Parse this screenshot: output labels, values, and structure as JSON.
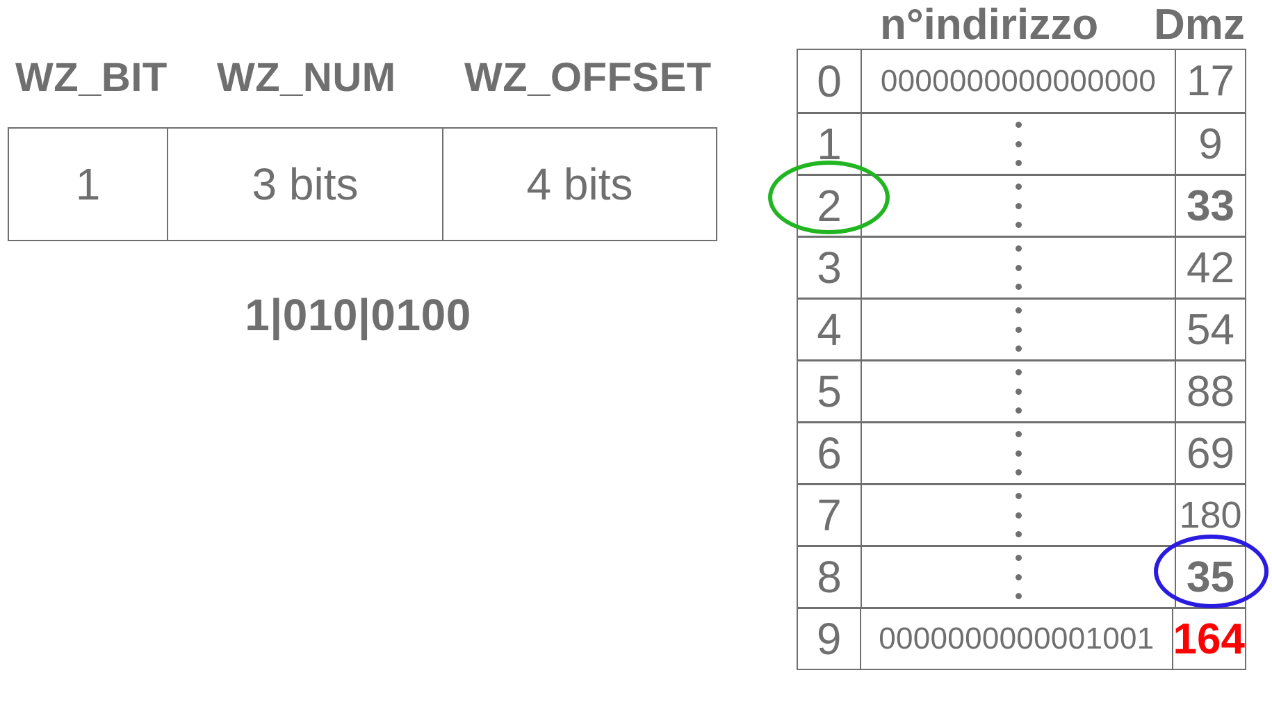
{
  "format": {
    "headers": [
      "WZ_BIT",
      "WZ_NUM",
      "WZ_OFFSET"
    ],
    "fields": [
      "1",
      "3 bits",
      "4 bits"
    ],
    "binary": "1|010|0100"
  },
  "table": {
    "col_address": "n°indirizzo",
    "col_dmz": "Dmz",
    "rows": [
      {
        "index": "0",
        "address": "0000000000000000",
        "dmz": "17"
      },
      {
        "index": "1",
        "address": "",
        "dmz": "9"
      },
      {
        "index": "2",
        "address": "",
        "dmz": "33"
      },
      {
        "index": "3",
        "address": "",
        "dmz": "42"
      },
      {
        "index": "4",
        "address": "",
        "dmz": "54"
      },
      {
        "index": "5",
        "address": "",
        "dmz": "88"
      },
      {
        "index": "6",
        "address": "",
        "dmz": "69"
      },
      {
        "index": "7",
        "address": "",
        "dmz": "180"
      },
      {
        "index": "8",
        "address": "",
        "dmz": "35"
      },
      {
        "index": "9",
        "address": "0000000000001001",
        "dmz": "164"
      }
    ]
  },
  "highlights": {
    "index_circle_color": "#22b522",
    "dmz_circle_color": "#2a1be0",
    "result_color": "#ff0000"
  }
}
